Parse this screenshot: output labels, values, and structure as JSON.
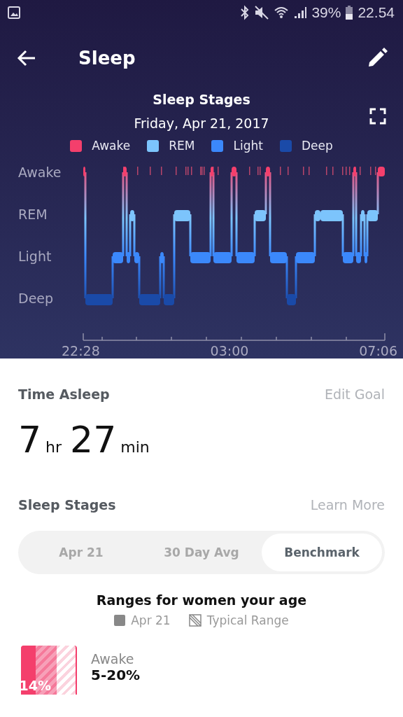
{
  "status_bar": {
    "battery": "39%",
    "time": "22.54"
  },
  "toolbar": {
    "title": "Sleep"
  },
  "chart_header": {
    "title": "Sleep Stages",
    "date": "Friday, Apr 21, 2017"
  },
  "legend": [
    {
      "label": "Awake",
      "color": "#f43f6c"
    },
    {
      "label": "REM",
      "color": "#7cc4fc"
    },
    {
      "label": "Light",
      "color": "#3b88fb"
    },
    {
      "label": "Deep",
      "color": "#1a4aa8"
    }
  ],
  "stage_labels": [
    "Awake",
    "REM",
    "Light",
    "Deep"
  ],
  "time_labels": [
    "22:28",
    "03:00",
    "07:06"
  ],
  "time_asleep": {
    "heading": "Time Asleep",
    "link": "Edit Goal",
    "hours": "7",
    "hours_unit": "hr",
    "minutes": "27",
    "minutes_unit": "min"
  },
  "sleep_stages": {
    "heading": "Sleep Stages",
    "link": "Learn More"
  },
  "tabs": [
    {
      "label": "Apr 21",
      "selected": false
    },
    {
      "label": "30 Day Avg",
      "selected": false
    },
    {
      "label": "Benchmark",
      "selected": true
    }
  ],
  "benchmark": {
    "title": "Ranges for women your age",
    "legend": [
      {
        "kind": "solid",
        "label": "Apr 21"
      },
      {
        "kind": "hatched",
        "label": "Typical Range"
      }
    ],
    "rows": [
      {
        "label": "Awake",
        "range": "5-20%",
        "value": "14%",
        "color": "#f43f6c"
      }
    ]
  }
}
